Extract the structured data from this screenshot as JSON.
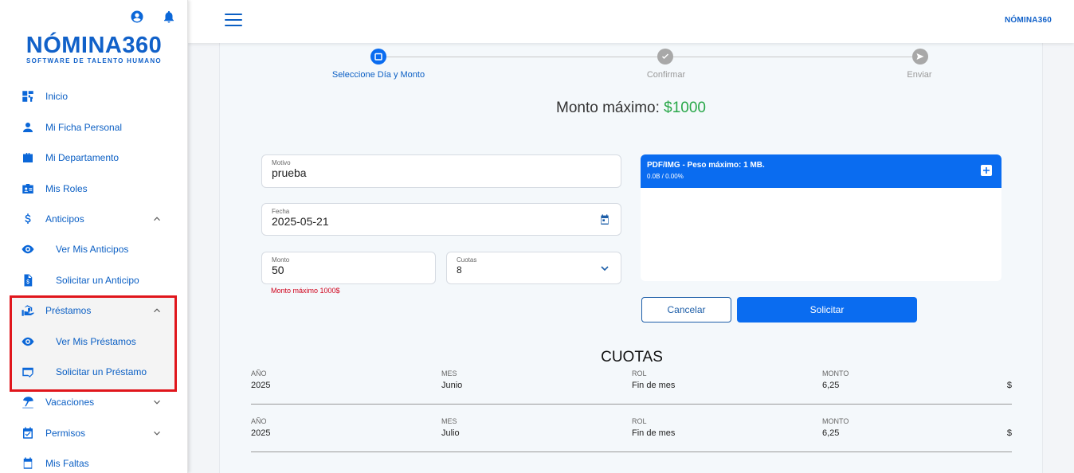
{
  "sidebar": {
    "logo_main": "NÓMINA360",
    "logo_sub": "SOFTWARE DE TALENTO HUMANO",
    "items": [
      {
        "label": "Inicio",
        "icon": "dashboard-icon"
      },
      {
        "label": "Mi Ficha Personal",
        "icon": "person-icon"
      },
      {
        "label": "Mi Departamento",
        "icon": "briefcase-icon"
      },
      {
        "label": "Mis Roles",
        "icon": "id-card-icon"
      },
      {
        "label": "Anticipos",
        "icon": "dollar-icon"
      },
      {
        "label": "Ver Mis Anticipos",
        "icon": "eye-icon"
      },
      {
        "label": "Solicitar un Anticipo",
        "icon": "file-dollar-icon"
      },
      {
        "label": "Préstamos",
        "icon": "loan-icon"
      },
      {
        "label": "Ver Mis Préstamos",
        "icon": "eye-icon"
      },
      {
        "label": "Solicitar un Préstamo",
        "icon": "card-check-icon"
      },
      {
        "label": "Vacaciones",
        "icon": "beach-icon"
      },
      {
        "label": "Permisos",
        "icon": "calendar-check-icon"
      },
      {
        "label": "Mis Faltas",
        "icon": "calendar-icon"
      }
    ]
  },
  "header": {
    "brand": "NÓMINA360"
  },
  "stepper": {
    "steps": [
      {
        "label": "Seleccione Día y Monto"
      },
      {
        "label": "Confirmar"
      },
      {
        "label": "Enviar"
      }
    ]
  },
  "form": {
    "max_prefix": "Monto máximo:",
    "max_amount": "$1000",
    "motivo_label": "Motivo",
    "motivo_value": "prueba",
    "fecha_label": "Fecha",
    "fecha_value": "2025-05-21",
    "monto_label": "Monto",
    "monto_value": "50",
    "cuotas_label": "Cuotas",
    "cuotas_value": "8",
    "error": "Monto máximo 1000$"
  },
  "upload": {
    "title": "PDF/IMG - Peso máximo: 1 MB.",
    "size": "0.0B / 0.00%"
  },
  "buttons": {
    "cancel": "Cancelar",
    "submit": "Solicitar"
  },
  "cuotas": {
    "title": "CUOTAS",
    "headers": {
      "year": "AÑO",
      "month": "MES",
      "rol": "ROL",
      "amount": "MONTO"
    },
    "rows": [
      {
        "year": "2025",
        "month": "Junio",
        "rol": "Fin de mes",
        "amount": "6,25",
        "currency": "$"
      },
      {
        "year": "2025",
        "month": "Julio",
        "rol": "Fin de mes",
        "amount": "6,25",
        "currency": "$"
      }
    ]
  },
  "colors": {
    "primary": "#0a6cf0",
    "brand": "#1161c9",
    "success": "#2aa84a",
    "error": "#d0021b",
    "highlight": "#e0161c"
  }
}
